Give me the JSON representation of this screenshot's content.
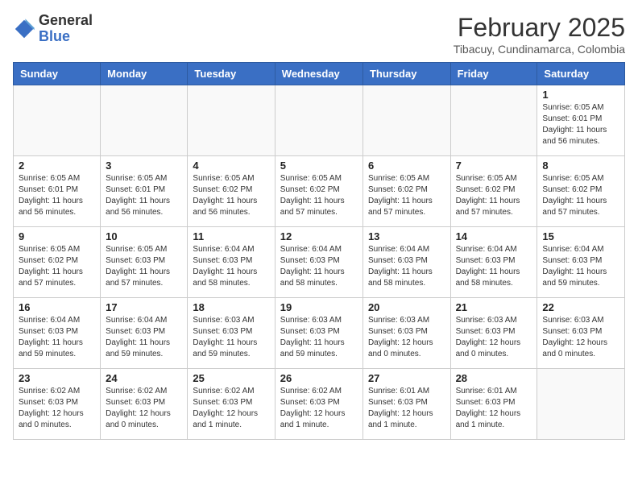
{
  "header": {
    "logo_general": "General",
    "logo_blue": "Blue",
    "month_title": "February 2025",
    "location": "Tibacuy, Cundinamarca, Colombia"
  },
  "calendar": {
    "days_of_week": [
      "Sunday",
      "Monday",
      "Tuesday",
      "Wednesday",
      "Thursday",
      "Friday",
      "Saturday"
    ],
    "weeks": [
      [
        {
          "day": "",
          "info": ""
        },
        {
          "day": "",
          "info": ""
        },
        {
          "day": "",
          "info": ""
        },
        {
          "day": "",
          "info": ""
        },
        {
          "day": "",
          "info": ""
        },
        {
          "day": "",
          "info": ""
        },
        {
          "day": "1",
          "info": "Sunrise: 6:05 AM\nSunset: 6:01 PM\nDaylight: 11 hours\nand 56 minutes."
        }
      ],
      [
        {
          "day": "2",
          "info": "Sunrise: 6:05 AM\nSunset: 6:01 PM\nDaylight: 11 hours\nand 56 minutes."
        },
        {
          "day": "3",
          "info": "Sunrise: 6:05 AM\nSunset: 6:01 PM\nDaylight: 11 hours\nand 56 minutes."
        },
        {
          "day": "4",
          "info": "Sunrise: 6:05 AM\nSunset: 6:02 PM\nDaylight: 11 hours\nand 56 minutes."
        },
        {
          "day": "5",
          "info": "Sunrise: 6:05 AM\nSunset: 6:02 PM\nDaylight: 11 hours\nand 57 minutes."
        },
        {
          "day": "6",
          "info": "Sunrise: 6:05 AM\nSunset: 6:02 PM\nDaylight: 11 hours\nand 57 minutes."
        },
        {
          "day": "7",
          "info": "Sunrise: 6:05 AM\nSunset: 6:02 PM\nDaylight: 11 hours\nand 57 minutes."
        },
        {
          "day": "8",
          "info": "Sunrise: 6:05 AM\nSunset: 6:02 PM\nDaylight: 11 hours\nand 57 minutes."
        }
      ],
      [
        {
          "day": "9",
          "info": "Sunrise: 6:05 AM\nSunset: 6:02 PM\nDaylight: 11 hours\nand 57 minutes."
        },
        {
          "day": "10",
          "info": "Sunrise: 6:05 AM\nSunset: 6:03 PM\nDaylight: 11 hours\nand 57 minutes."
        },
        {
          "day": "11",
          "info": "Sunrise: 6:04 AM\nSunset: 6:03 PM\nDaylight: 11 hours\nand 58 minutes."
        },
        {
          "day": "12",
          "info": "Sunrise: 6:04 AM\nSunset: 6:03 PM\nDaylight: 11 hours\nand 58 minutes."
        },
        {
          "day": "13",
          "info": "Sunrise: 6:04 AM\nSunset: 6:03 PM\nDaylight: 11 hours\nand 58 minutes."
        },
        {
          "day": "14",
          "info": "Sunrise: 6:04 AM\nSunset: 6:03 PM\nDaylight: 11 hours\nand 58 minutes."
        },
        {
          "day": "15",
          "info": "Sunrise: 6:04 AM\nSunset: 6:03 PM\nDaylight: 11 hours\nand 59 minutes."
        }
      ],
      [
        {
          "day": "16",
          "info": "Sunrise: 6:04 AM\nSunset: 6:03 PM\nDaylight: 11 hours\nand 59 minutes."
        },
        {
          "day": "17",
          "info": "Sunrise: 6:04 AM\nSunset: 6:03 PM\nDaylight: 11 hours\nand 59 minutes."
        },
        {
          "day": "18",
          "info": "Sunrise: 6:03 AM\nSunset: 6:03 PM\nDaylight: 11 hours\nand 59 minutes."
        },
        {
          "day": "19",
          "info": "Sunrise: 6:03 AM\nSunset: 6:03 PM\nDaylight: 11 hours\nand 59 minutes."
        },
        {
          "day": "20",
          "info": "Sunrise: 6:03 AM\nSunset: 6:03 PM\nDaylight: 12 hours\nand 0 minutes."
        },
        {
          "day": "21",
          "info": "Sunrise: 6:03 AM\nSunset: 6:03 PM\nDaylight: 12 hours\nand 0 minutes."
        },
        {
          "day": "22",
          "info": "Sunrise: 6:03 AM\nSunset: 6:03 PM\nDaylight: 12 hours\nand 0 minutes."
        }
      ],
      [
        {
          "day": "23",
          "info": "Sunrise: 6:02 AM\nSunset: 6:03 PM\nDaylight: 12 hours\nand 0 minutes."
        },
        {
          "day": "24",
          "info": "Sunrise: 6:02 AM\nSunset: 6:03 PM\nDaylight: 12 hours\nand 0 minutes."
        },
        {
          "day": "25",
          "info": "Sunrise: 6:02 AM\nSunset: 6:03 PM\nDaylight: 12 hours\nand 1 minute."
        },
        {
          "day": "26",
          "info": "Sunrise: 6:02 AM\nSunset: 6:03 PM\nDaylight: 12 hours\nand 1 minute."
        },
        {
          "day": "27",
          "info": "Sunrise: 6:01 AM\nSunset: 6:03 PM\nDaylight: 12 hours\nand 1 minute."
        },
        {
          "day": "28",
          "info": "Sunrise: 6:01 AM\nSunset: 6:03 PM\nDaylight: 12 hours\nand 1 minute."
        },
        {
          "day": "",
          "info": ""
        }
      ]
    ]
  }
}
